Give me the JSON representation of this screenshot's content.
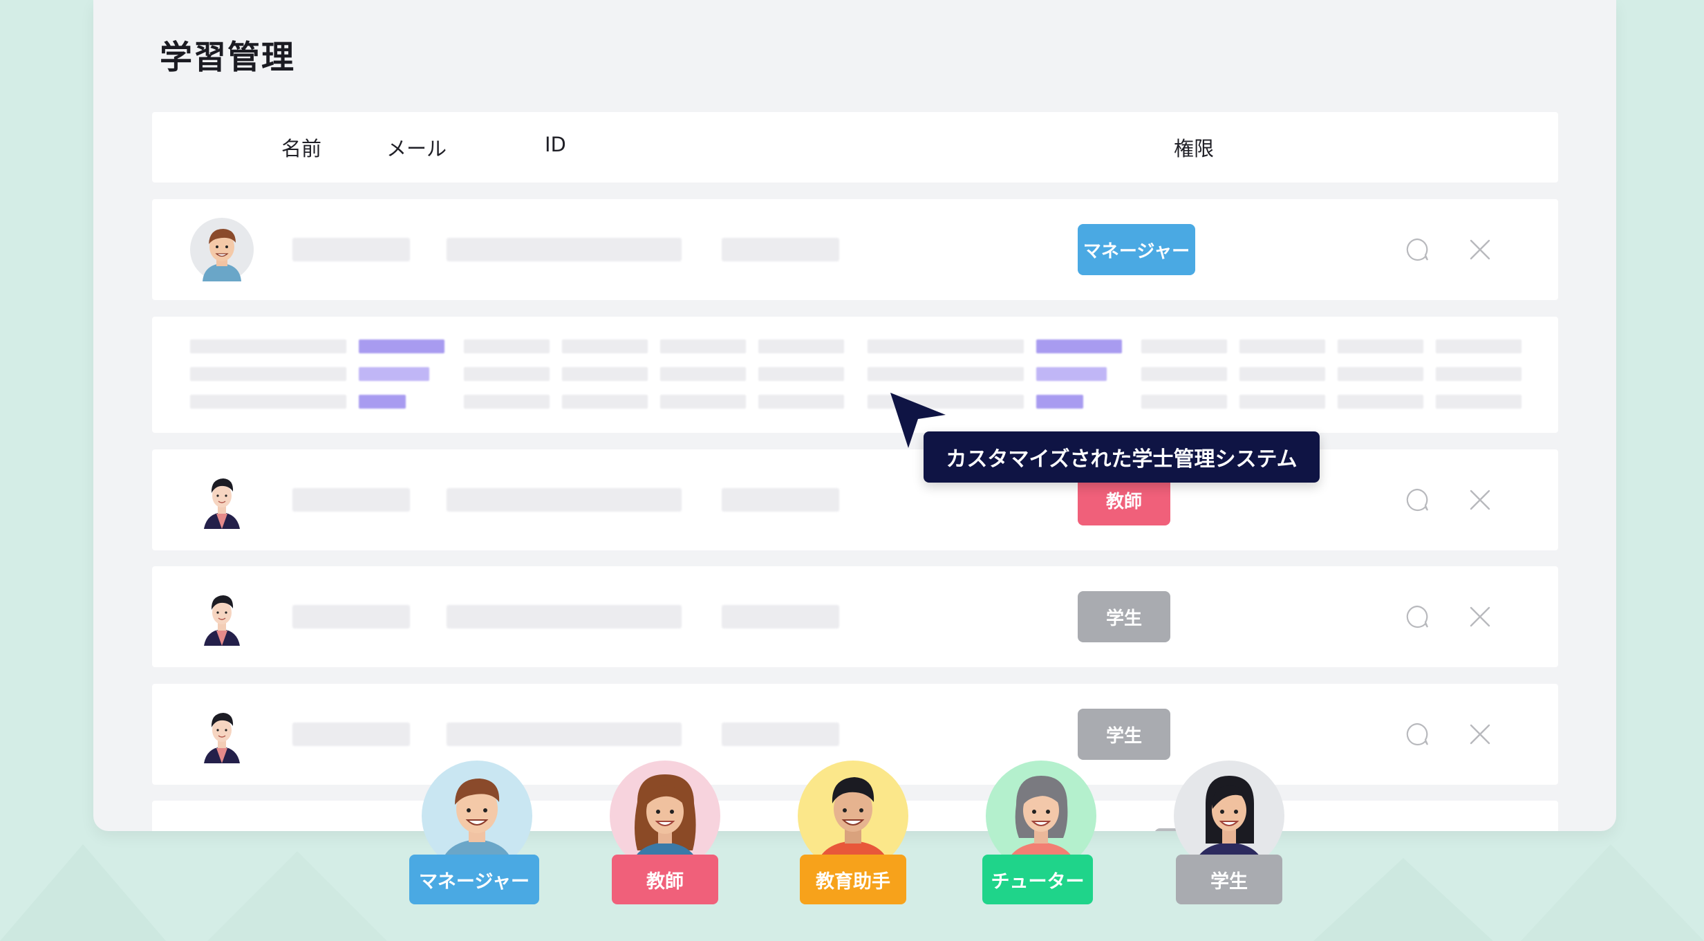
{
  "page_title": "学習管理",
  "table_headers": {
    "name": "名前",
    "email": "メール",
    "id": "ID",
    "permission": "権限"
  },
  "rows": [
    {
      "role": "マネージャー",
      "role_color": "#4aa9e3",
      "avatar": "manager-avatar-icon"
    },
    {
      "role": "教師",
      "role_color": "#f0607a",
      "avatar": "teacher-avatar-icon"
    },
    {
      "role": "学生",
      "role_color": "#a9abb0",
      "avatar": "student-avatar-icon"
    },
    {
      "role": "学生",
      "role_color": "#a9abb0",
      "avatar": "student-avatar-icon"
    }
  ],
  "actions": {
    "comment_icon": "comment-icon",
    "delete_icon": "close-icon"
  },
  "tooltip": "カスタマイズされた学士管理システム",
  "personas": [
    {
      "label": "マネージャー",
      "tag_color": "#4aa9e3",
      "circle_color": "#c9e6f2"
    },
    {
      "label": "教師",
      "tag_color": "#f0607a",
      "circle_color": "#f7d3dd"
    },
    {
      "label": "教育助手",
      "tag_color": "#f7a21b",
      "circle_color": "#fbe78a"
    },
    {
      "label": "チューター",
      "tag_color": "#1fd48a",
      "circle_color": "#b4f0cd"
    },
    {
      "label": "学生",
      "tag_color": "#a9abb0",
      "circle_color": "#e5e7ea"
    }
  ],
  "colors": {
    "background": "#d4ede6",
    "panel": "#f2f3f5",
    "accent_purple": "#a89bf0",
    "tooltip_bg": "#0f1444"
  }
}
